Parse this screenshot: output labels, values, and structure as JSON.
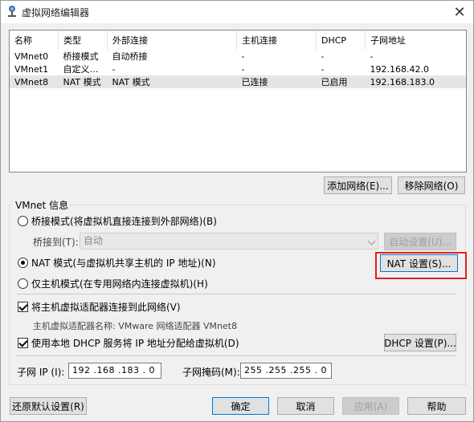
{
  "window": {
    "title": "虚拟网络编辑器",
    "close_glyph": "✕"
  },
  "table": {
    "headers": [
      "名称",
      "类型",
      "外部连接",
      "主机连接",
      "DHCP",
      "子网地址"
    ],
    "rows": [
      [
        "VMnet0",
        "桥接模式",
        "自动桥接",
        "-",
        "-",
        "-"
      ],
      [
        "VMnet1",
        "自定义…",
        "-",
        "-",
        "-",
        "192.168.42.0"
      ],
      [
        "VMnet8",
        "NAT 模式",
        "NAT 模式",
        "已连接",
        "已启用",
        "192.168.183.0"
      ]
    ],
    "selected_row": 2
  },
  "buttons": {
    "add_network": "添加网络(E)...",
    "remove_network": "移除网络(O)",
    "auto_settings": "自动设置(U)...",
    "nat_settings": "NAT 设置(S)...",
    "dhcp_settings": "DHCP 设置(P)...",
    "restore_defaults": "还原默认设置(R)",
    "ok": "确定",
    "cancel": "取消",
    "apply": "应用(A)",
    "help": "帮助"
  },
  "vmnet_info": {
    "group_label": "VMnet 信息",
    "bridge_mode": "桥接模式(将虚拟机直接连接到外部网络)(B)",
    "bridge_to_label": "桥接到(T):",
    "bridge_to_value": "自动",
    "nat_mode": "NAT 模式(与虚拟机共享主机的 IP 地址)(N)",
    "host_only_mode": "仅主机模式(在专用网络内连接虚拟机)(H)",
    "selected_mode": "nat",
    "connect_adapter": "将主机虚拟适配器连接到此网络(V)",
    "connect_adapter_checked": true,
    "adapter_name_label": "主机虚拟适配器名称: VMware 网络适配器 VMnet8",
    "use_dhcp": "使用本地 DHCP 服务将 IP 地址分配给虚拟机(D)",
    "use_dhcp_checked": true,
    "subnet_ip_label": "子网 IP (I):",
    "subnet_ip": "192 .168 .183 . 0",
    "subnet_mask_label": "子网掩码(M):",
    "subnet_mask": "255 .255 .255 . 0"
  },
  "icons": {
    "app": "vmware-network-icon",
    "close": "close-icon",
    "dropdown": "chevron-down-icon"
  },
  "colors": {
    "highlight": "#e02020",
    "selected_row": "#e5e5e5"
  }
}
